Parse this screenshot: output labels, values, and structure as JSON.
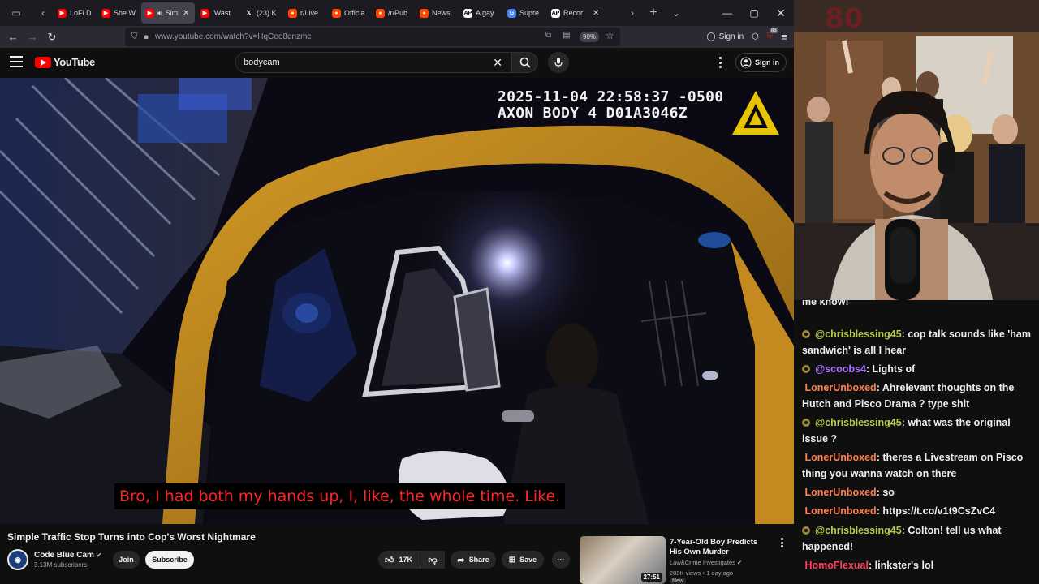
{
  "browser": {
    "tabs": [
      {
        "label": "LoFi D",
        "favicon": "youtube",
        "active": false
      },
      {
        "label": "She W",
        "favicon": "youtube",
        "active": false
      },
      {
        "label": "Sim",
        "favicon": "youtube",
        "active": true,
        "audio": true
      },
      {
        "label": "'Wast",
        "favicon": "youtube",
        "active": false
      },
      {
        "label": "(23) K",
        "favicon": "x",
        "active": false
      },
      {
        "label": "r/Live",
        "favicon": "reddit",
        "active": false
      },
      {
        "label": "Officia",
        "favicon": "reddit",
        "active": false
      },
      {
        "label": "/r/Pub",
        "favicon": "reddit",
        "active": false
      },
      {
        "label": "News",
        "favicon": "reddit",
        "active": false
      },
      {
        "label": "A gay",
        "favicon": "ap",
        "active": false
      },
      {
        "label": "Supre",
        "favicon": "google",
        "active": false
      },
      {
        "label": "Recor",
        "favicon": "ap",
        "active": false
      }
    ],
    "url": "www.youtube.com/watch?v=HqCeo8qnzmc",
    "zoom": "90%",
    "sign_in": "Sign in",
    "extension_badge": "83"
  },
  "youtube": {
    "logo_text": "YouTube",
    "search_value": "bodycam",
    "sign_in": "Sign in"
  },
  "video": {
    "overlay_timestamp": "2025-11-04 22:58:37 -0500",
    "overlay_device": "AXON BODY 4 D01A3046Z",
    "caption": "Bro, I had both my hands up, I, like, the whole time. Like."
  },
  "details": {
    "title": "Simple Traffic Stop Turns into Cop's Worst Nightmare",
    "channel": "Code Blue Cam",
    "subscribers": "3.13M subscribers",
    "join_label": "Join",
    "subscribe_label": "Subscribe",
    "likes": "17K",
    "share_label": "Share",
    "save_label": "Save"
  },
  "recommended": {
    "title": "7-Year-Old Boy Predicts His Own Murder",
    "channel": "Law&Crime Investigates",
    "meta": "288K views • 1 day ago",
    "badge": "New",
    "duration": "27:51"
  },
  "chat": {
    "messages": [
      {
        "user": "",
        "text": "me know!",
        "badge": false,
        "color": "#efeff1"
      },
      {
        "user": "@chrisblessing45",
        "text": ": cop talk sounds like 'ham sandwich' is all I hear",
        "badge": true,
        "color": "#b9c94b"
      },
      {
        "user": "@scoobs4",
        "text": ": Lights of",
        "badge": true,
        "color": "#a970ff"
      },
      {
        "user": "LonerUnboxed",
        "text": ": Ahrelevant thoughts on the Hutch and Pisco Drama ? type shit",
        "badge": false,
        "color": "#ff7f50"
      },
      {
        "user": "@chrisblessing45",
        "text": ": what was the original issue ?",
        "badge": true,
        "color": "#b9c94b"
      },
      {
        "user": "LonerUnboxed",
        "text": ": theres a Livestream on Pisco thing you wanna watch on there",
        "badge": false,
        "color": "#ff7f50"
      },
      {
        "user": "LonerUnboxed",
        "text": ": so",
        "badge": false,
        "color": "#ff7f50"
      },
      {
        "user": "LonerUnboxed",
        "text": ": https://t.co/v1t9CsZvC4",
        "badge": false,
        "color": "#ff7f50"
      },
      {
        "user": "@chrisblessing45",
        "text": ": Colton! tell us what happened!",
        "badge": true,
        "color": "#b9c94b"
      },
      {
        "user": "HomoFlexual",
        "text": ": linkster's lol",
        "badge": false,
        "color": "#ff4060"
      }
    ]
  }
}
